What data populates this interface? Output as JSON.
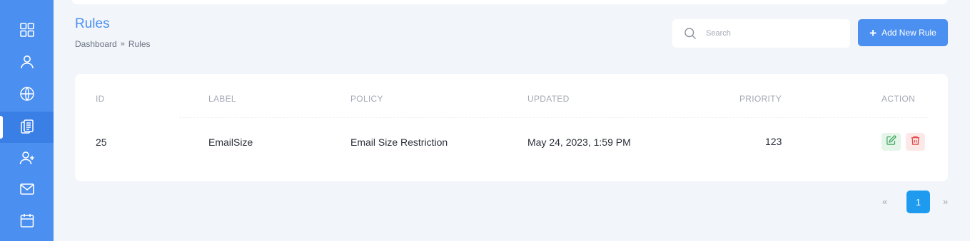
{
  "sidebar": {
    "items": [
      {
        "name": "dashboard",
        "icon": "grid-icon",
        "active": false
      },
      {
        "name": "user",
        "icon": "user-icon",
        "active": false
      },
      {
        "name": "globe",
        "icon": "globe-icon",
        "active": false
      },
      {
        "name": "rules",
        "icon": "documents-icon",
        "active": true
      },
      {
        "name": "add-user",
        "icon": "user-plus-icon",
        "active": false
      },
      {
        "name": "mail",
        "icon": "mail-icon",
        "active": false
      },
      {
        "name": "calendar",
        "icon": "calendar-icon",
        "active": false
      }
    ]
  },
  "header": {
    "title": "Rules",
    "breadcrumb": {
      "home": "Dashboard",
      "separator": "»",
      "current": "Rules"
    }
  },
  "search": {
    "placeholder": "Search",
    "value": ""
  },
  "toolbar": {
    "add_label": "Add New Rule",
    "add_icon": "+"
  },
  "table": {
    "columns": {
      "id": "ID",
      "label": "LABEL",
      "policy": "POLICY",
      "updated": "UPDATED",
      "priority": "PRIORITY",
      "action": "ACTION"
    },
    "rows": [
      {
        "id": "25",
        "label": "EmailSize",
        "policy": "Email Size Restriction",
        "updated": "May 24, 2023, 1:59 PM",
        "priority": "123"
      }
    ]
  },
  "pagination": {
    "prev": "«",
    "current": "1",
    "next": "»"
  },
  "colors": {
    "accent": "#4b8ff0",
    "page_active": "#1e9bef",
    "edit_bg": "#e6f5ea",
    "delete_bg": "#fde8e8"
  }
}
